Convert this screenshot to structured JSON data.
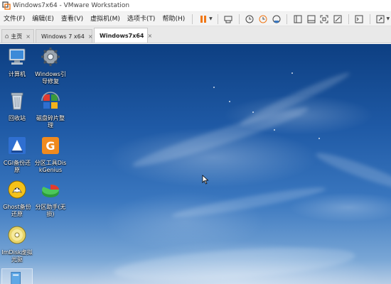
{
  "window": {
    "title": "Windows7x64 - VMware Workstation"
  },
  "menu": {
    "items": [
      "文件(F)",
      "编辑(E)",
      "查看(V)",
      "虚拟机(M)",
      "选项卡(T)",
      "帮助(H)"
    ]
  },
  "tabs": [
    {
      "label": "主页"
    },
    {
      "label": "Windows 7 x64"
    },
    {
      "label": "Windows7x64"
    }
  ],
  "desktop_icons": [
    {
      "label": "计算机",
      "icon": "computer-icon"
    },
    {
      "label": "Windows引导修复",
      "icon": "gear-icon"
    },
    {
      "label": "回收站",
      "icon": "recycle-bin-icon"
    },
    {
      "label": "磁盘碎片整理",
      "icon": "defrag-icon"
    },
    {
      "label": "CGI备份还原",
      "icon": "cgi-icon"
    },
    {
      "label": "分区工具DiskGenius",
      "icon": "diskgenius-icon"
    },
    {
      "label": "Ghost备份还原",
      "icon": "ghost-icon"
    },
    {
      "label": "分区助手(无损)",
      "icon": "partition-assistant-icon"
    },
    {
      "label": "ImDisk虚拟光驱",
      "icon": "imdisk-icon"
    }
  ],
  "colors": {
    "accent_pause": "#f07818",
    "desktop_top": "#0d3f82",
    "desktop_bottom": "#b7cde6"
  }
}
